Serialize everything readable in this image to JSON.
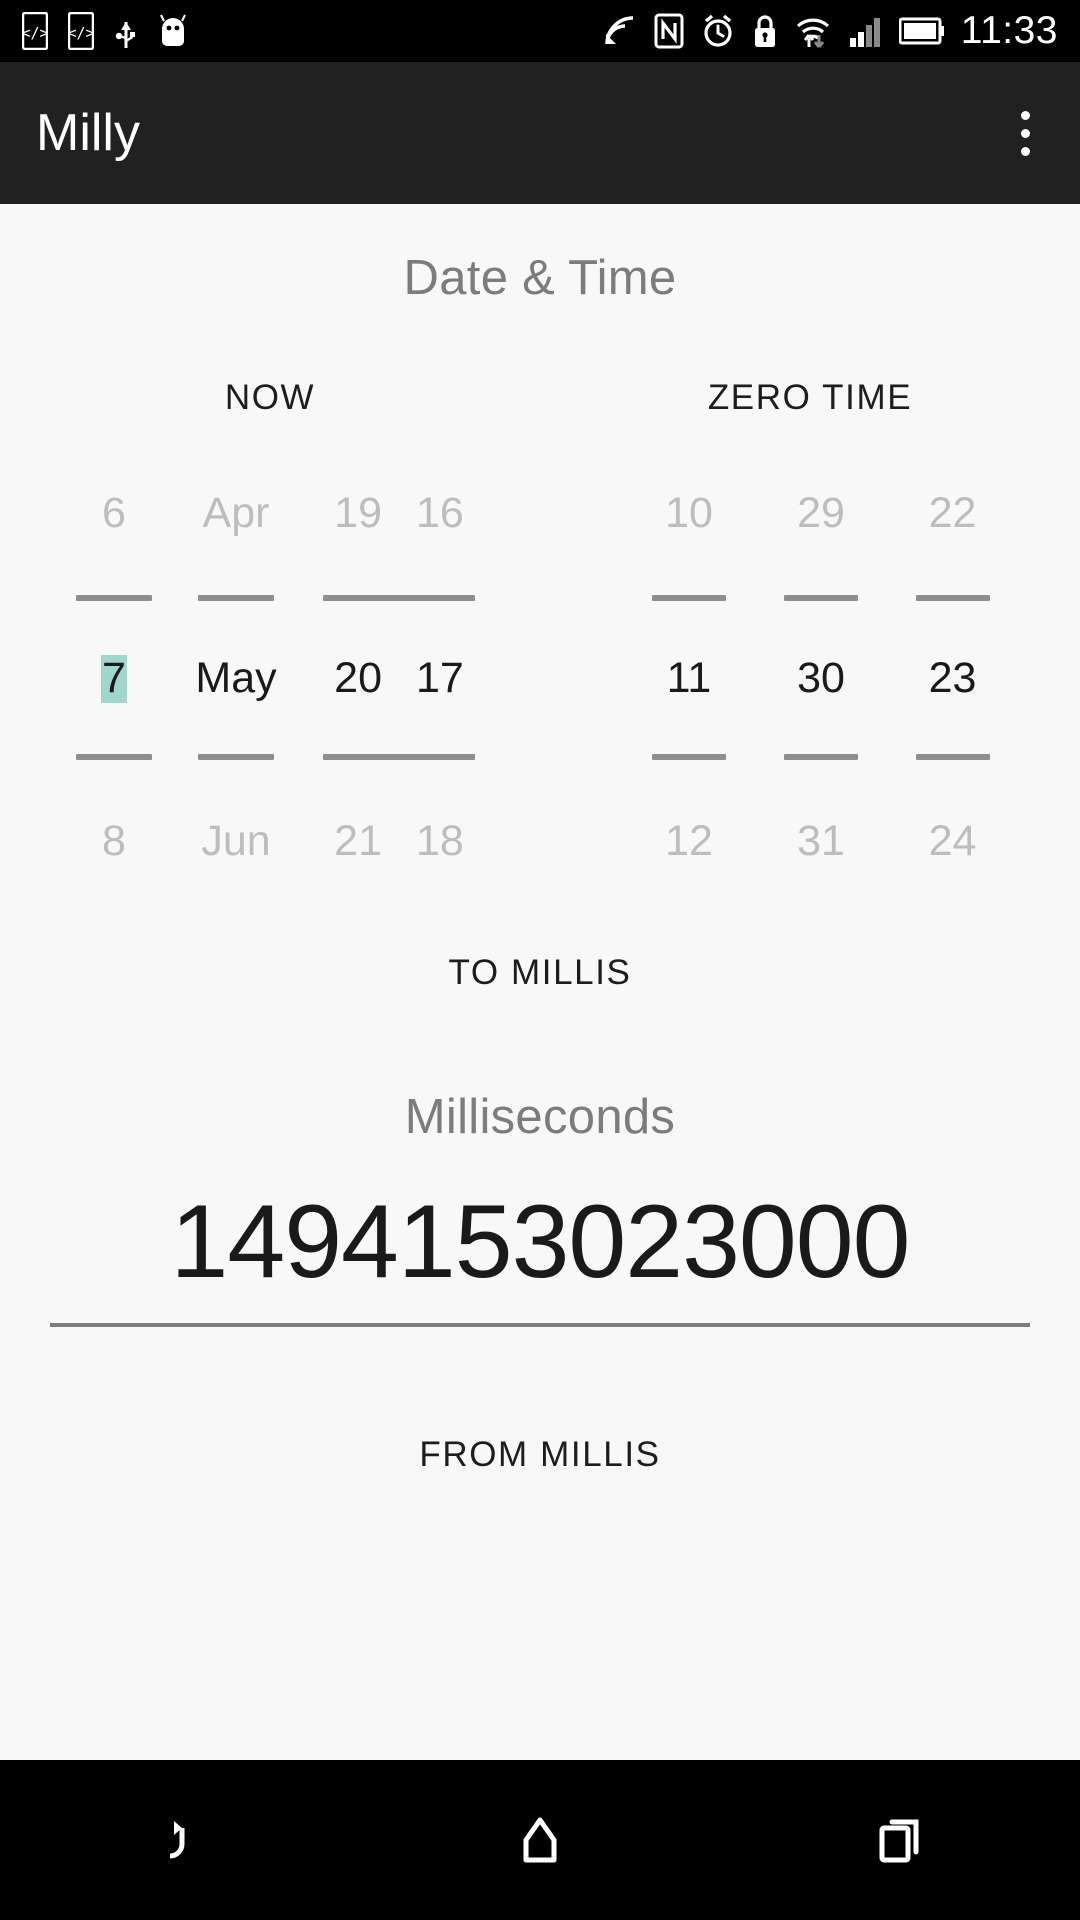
{
  "statusbar": {
    "time": "11:33",
    "left_icons": [
      {
        "name": "adb-code-icon-1",
        "label": "</>"
      },
      {
        "name": "adb-code-icon-2",
        "label": "</>"
      },
      {
        "name": "usb-debugging-icon",
        "label": "usb"
      },
      {
        "name": "android-bugdroid-icon",
        "label": "android"
      }
    ],
    "right_icons": [
      {
        "name": "cast-screen-icon",
        "label": "cast"
      },
      {
        "name": "nfc-icon",
        "label": "N"
      },
      {
        "name": "alarm-clock-icon",
        "label": "alarm"
      },
      {
        "name": "screen-lock-icon",
        "label": "lock"
      },
      {
        "name": "wifi-icon",
        "label": "wifi"
      },
      {
        "name": "cellular-signal-icon",
        "label": "signal"
      },
      {
        "name": "battery-icon",
        "label": "battery"
      }
    ]
  },
  "appbar": {
    "title": "Milly",
    "overflow_label": "More options"
  },
  "main": {
    "section_title": "Date & Time",
    "now_button": "NOW",
    "zero_time_button": "ZERO TIME",
    "to_millis_button": "TO MILLIS",
    "milliseconds_label": "Milliseconds",
    "milliseconds_value": "1494153023000",
    "from_millis_button": "FROM MILLIS"
  },
  "pickers": {
    "day": {
      "prev": "6",
      "current": "7",
      "next": "8"
    },
    "month": {
      "prev": "Apr",
      "current": "May",
      "next": "Jun"
    },
    "year": {
      "prev_a": "19",
      "prev_b": "16",
      "current_a": "20",
      "current_b": "17",
      "next_a": "21",
      "next_b": "18"
    },
    "hour": {
      "prev": "10",
      "current": "11",
      "next": "12"
    },
    "minute": {
      "prev": "29",
      "current": "30",
      "next": "31"
    },
    "second": {
      "prev": "22",
      "current": "23",
      "next": "24"
    }
  },
  "navbar": {
    "back": "Back",
    "home": "Home",
    "recents": "Recent apps"
  },
  "colors": {
    "accent_highlight": "#9fd7cc",
    "appbar_bg": "#212121",
    "page_bg": "#f8f8f8",
    "divider": "#8e8e8e",
    "muted_text": "#bdbdbd",
    "label_text": "#7c7c7c"
  }
}
